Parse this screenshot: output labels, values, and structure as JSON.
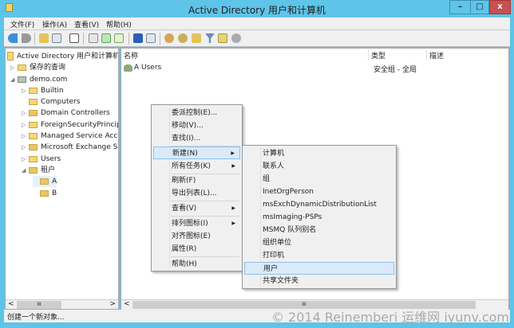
{
  "window": {
    "title": "Active Directory 用户和计算机",
    "minimize": "–",
    "maximize": "□",
    "close": "x"
  },
  "menubar": [
    "文件(F)",
    "操作(A)",
    "查看(V)",
    "帮助(H)"
  ],
  "tree": {
    "root": "Active Directory 用户和计算机",
    "items": [
      {
        "label": "保存的查询",
        "expander": "▷"
      },
      {
        "label": "demo.com",
        "expander": "◢"
      },
      {
        "label": "Builtin",
        "expander": "▷"
      },
      {
        "label": "Computers",
        "expander": ""
      },
      {
        "label": "Domain Controllers",
        "expander": "▷"
      },
      {
        "label": "ForeignSecurityPrincipals",
        "expander": "▷"
      },
      {
        "label": "Managed Service Accounts",
        "expander": "▷"
      },
      {
        "label": "Microsoft Exchange Security Groups",
        "expander": "▷"
      },
      {
        "label": "Users",
        "expander": "▷"
      },
      {
        "label": "租户",
        "expander": "◢"
      },
      {
        "label": "A",
        "expander": ""
      },
      {
        "label": "B",
        "expander": ""
      }
    ]
  },
  "list": {
    "columns": [
      "名称",
      "类型",
      "描述"
    ],
    "rows": [
      {
        "name": "A Users",
        "type": "安全组 - 全局",
        "desc": ""
      }
    ]
  },
  "context_menu": [
    "委派控制(E)...",
    "移动(V)...",
    "查找(I)...",
    "新建(N)",
    "所有任务(K)",
    "刷新(F)",
    "导出列表(L)...",
    "查看(V)",
    "排列图标(I)",
    "对齐图标(E)",
    "属性(R)",
    "帮助(H)"
  ],
  "submenu": [
    "计算机",
    "联系人",
    "组",
    "InetOrgPerson",
    "msExchDynamicDistributionList",
    "msImaging-PSPs",
    "MSMQ 队列别名",
    "组织单位",
    "打印机",
    "用户",
    "共享文件夹"
  ],
  "scroll": {
    "left": "<",
    "right": ">",
    "thumb": "III"
  },
  "status": "创建一个新对象...",
  "watermark": "© 2014 Reinemberi  运维网 iyunv.com"
}
